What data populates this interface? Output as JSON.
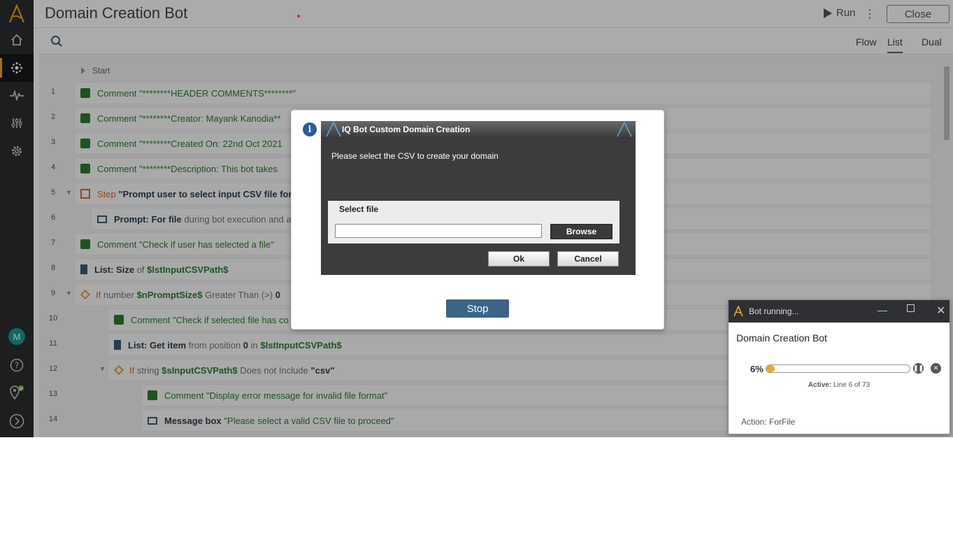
{
  "app": {
    "title": "Domain Creation Bot",
    "run_label": "Run",
    "close_label": "Close"
  },
  "views": {
    "flow": "Flow",
    "list": "List",
    "dual": "Dual",
    "selected": "List"
  },
  "start_label": "Start",
  "rows": [
    {
      "n": "1",
      "kw": "Comment",
      "text": "\"********HEADER COMMENTS********\""
    },
    {
      "n": "2",
      "kw": "Comment",
      "text": "\"********Creator: Mayank Kanodia**"
    },
    {
      "n": "3",
      "kw": "Comment",
      "text": "\"********Created On: 22nd Oct 2021"
    },
    {
      "n": "4",
      "kw": "Comment",
      "text": "\"********Description: This bot takes"
    },
    {
      "n": "5",
      "kw": "Step",
      "text": "\"Prompt user to select input CSV file for D"
    },
    {
      "n": "6",
      "kw": "Prompt: For file",
      "text": "during bot execution and a"
    },
    {
      "n": "7",
      "kw": "Comment",
      "text": "\"Check if user has selected a file\""
    },
    {
      "n": "8",
      "kw": "List: Size",
      "of": "of",
      "var": "$lstInputCSVPath$"
    },
    {
      "n": "9",
      "kw": "If",
      "pre": "number",
      "var": "$nPromptSize$",
      "mid": "Greater Than (>)",
      "val": "0"
    },
    {
      "n": "10",
      "kw": "Comment",
      "text": "\"Check if selected file has co"
    },
    {
      "n": "11",
      "kw": "List: Get item",
      "pre": "from position",
      "val": "0",
      "mid": "in",
      "var": "$lstInputCSVPath$"
    },
    {
      "n": "12",
      "kw": "If",
      "pre": "string",
      "var": "$sInputCSVPath$",
      "mid": "Does not Include",
      "val": "\"csv\""
    },
    {
      "n": "13",
      "kw": "Comment",
      "text": "\"Display error message for invalid file format\""
    },
    {
      "n": "14",
      "kw": "Message box",
      "text": "\"Please select a valid CSV file to proceed\""
    }
  ],
  "dialog": {
    "title": "IQ Bot Custom Domain Creation",
    "message": "Please select the CSV to create your domain",
    "select_label": "Select file",
    "file_value": "",
    "browse_label": "Browse",
    "ok_label": "Ok",
    "cancel_label": "Cancel"
  },
  "stop_label": "Stop",
  "bot_window": {
    "title": "Bot running...",
    "bot_name": "Domain Creation Bot",
    "progress_pct": "6%",
    "progress_fraction": 0.06,
    "active_label": "Active:",
    "active_value": "Line 6 of 73",
    "action": "Action: ForFile"
  },
  "colors": {
    "accent": "#f5a623",
    "comment": "#2e7d32",
    "step": "#e0662e",
    "stop_button": "#3b6488"
  },
  "avatar_letter": "M"
}
